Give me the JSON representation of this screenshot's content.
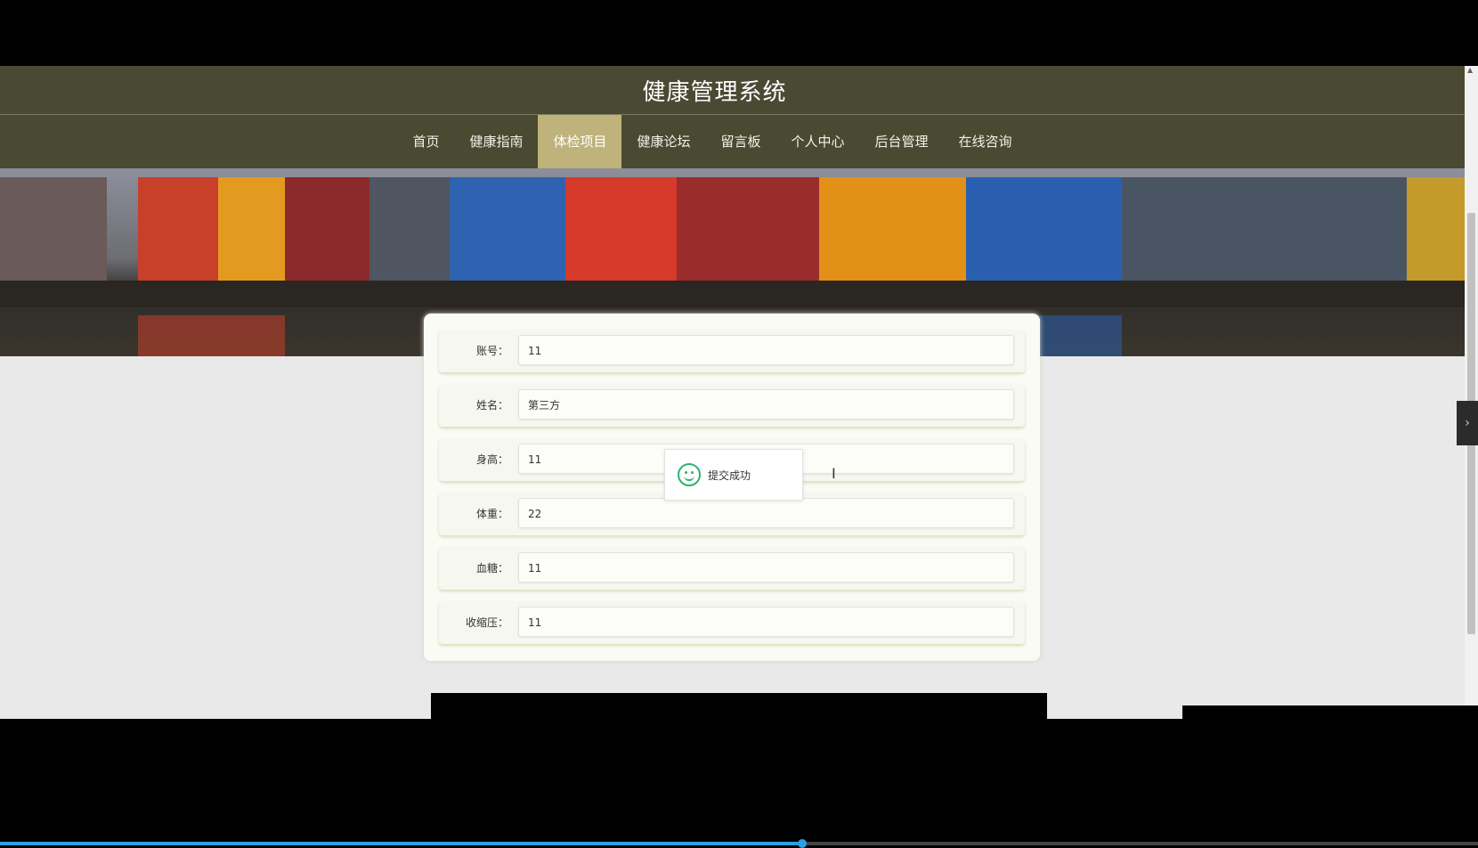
{
  "header": {
    "title": "健康管理系统"
  },
  "nav": {
    "items": [
      {
        "label": "首页",
        "active": false
      },
      {
        "label": "健康指南",
        "active": false
      },
      {
        "label": "体检项目",
        "active": true
      },
      {
        "label": "健康论坛",
        "active": false
      },
      {
        "label": "留言板",
        "active": false
      },
      {
        "label": "个人中心",
        "active": false
      },
      {
        "label": "后台管理",
        "active": false
      },
      {
        "label": "在线咨询",
        "active": false
      }
    ]
  },
  "banner": {
    "slide_count": 3,
    "active_slide": 2
  },
  "form": {
    "fields": [
      {
        "label": "账号：",
        "value": "11"
      },
      {
        "label": "姓名：",
        "value": "第三方"
      },
      {
        "label": "身高：",
        "value": "11"
      },
      {
        "label": "体重：",
        "value": "22"
      },
      {
        "label": "血糖：",
        "value": "11"
      },
      {
        "label": "收缩压：",
        "value": "11"
      }
    ]
  },
  "toast": {
    "message": "提交成功"
  },
  "side_tab": {
    "icon": "chevron-right-icon",
    "glyph": "›"
  },
  "colors": {
    "header_bg": "#4a4a33",
    "nav_active_bg": "#bfb27a",
    "toast_icon": "#2fb26e",
    "video_progress": "#2aa0e0"
  },
  "video": {
    "progress": 0.543
  }
}
